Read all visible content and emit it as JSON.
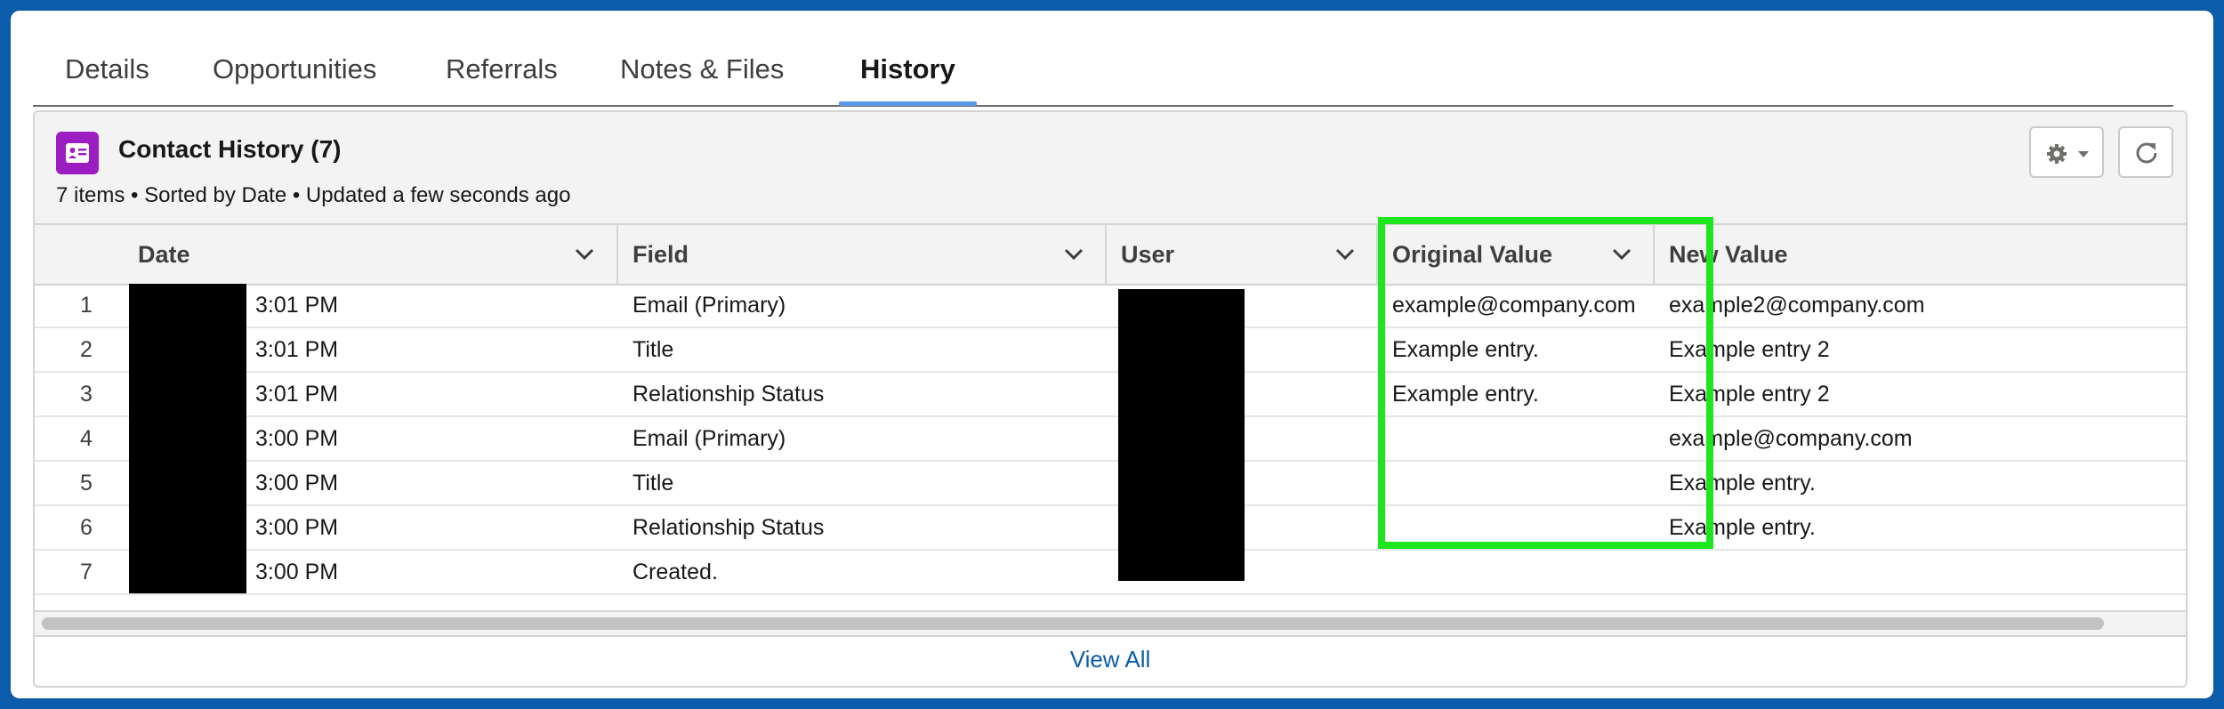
{
  "tabs": [
    "Details",
    "Opportunities",
    "Referrals",
    "Notes & Files",
    "History"
  ],
  "card": {
    "title": "Contact History (7)",
    "meta": "7 items • Sorted by Date • Updated a few seconds ago"
  },
  "icons": {
    "card": "contact-card-icon",
    "gear": "gear-icon",
    "refresh": "refresh-icon",
    "column_menu": "chevron-down-icon"
  },
  "colors": {
    "accent": "#0b5cab",
    "card_icon": "#9c1ec2",
    "highlight": "#1ee61e",
    "active_tab": "#5a9be8"
  },
  "table": {
    "columns": [
      "Date",
      "Field",
      "User",
      "Original Value",
      "New Value"
    ],
    "rows": [
      {
        "num": "1",
        "time": "3:01 PM",
        "field": "Email (Primary)",
        "original": "example@company.com",
        "new": "example2@company.com"
      },
      {
        "num": "2",
        "time": "3:01 PM",
        "field": "Title",
        "original": "Example entry.",
        "new": "Example entry 2"
      },
      {
        "num": "3",
        "time": "3:01 PM",
        "field": "Relationship Status",
        "original": "Example entry.",
        "new": "Example entry 2"
      },
      {
        "num": "4",
        "time": "3:00 PM",
        "field": "Email (Primary)",
        "original": "",
        "new": "example@company.com"
      },
      {
        "num": "5",
        "time": "3:00 PM",
        "field": "Title",
        "original": "",
        "new": "Example entry."
      },
      {
        "num": "6",
        "time": "3:00 PM",
        "field": "Relationship Status",
        "original": "",
        "new": "Example entry."
      },
      {
        "num": "7",
        "time": "3:00 PM",
        "field": "Created.",
        "original": "",
        "new": ""
      }
    ]
  },
  "footer": {
    "view_all": "View All"
  }
}
